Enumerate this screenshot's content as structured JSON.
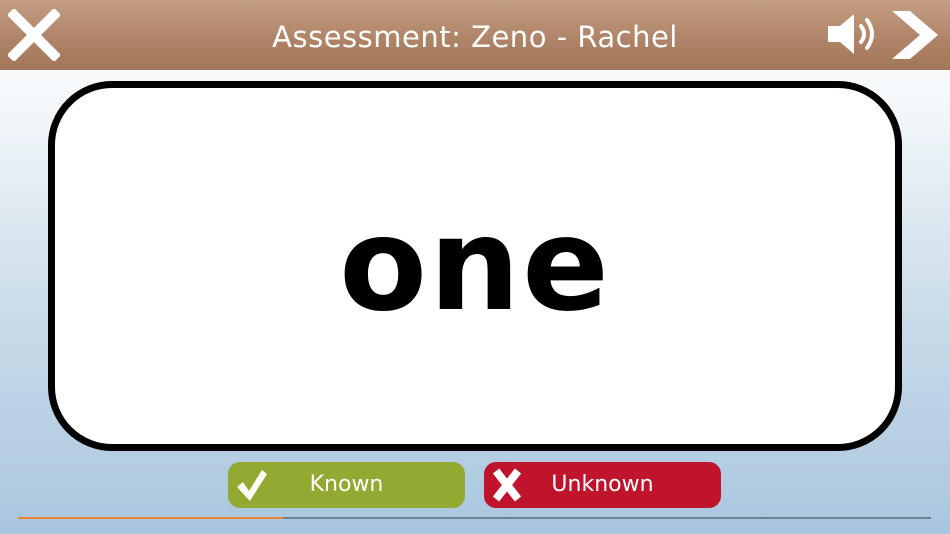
{
  "header": {
    "title": "Assessment: Zeno - Rachel"
  },
  "icons": {
    "close": "close-icon",
    "sound": "speaker-icon",
    "next": "chevron-right-icon"
  },
  "card": {
    "word": "one"
  },
  "buttons": {
    "known_label": "Known",
    "unknown_label": "Unknown"
  },
  "progress": {
    "fraction": 0.29
  },
  "colors": {
    "header": "#a97c5f",
    "known": "#93aa32",
    "unknown": "#c0132c",
    "progress_fill": "#e8862f",
    "progress_track": "#6b7f96"
  }
}
